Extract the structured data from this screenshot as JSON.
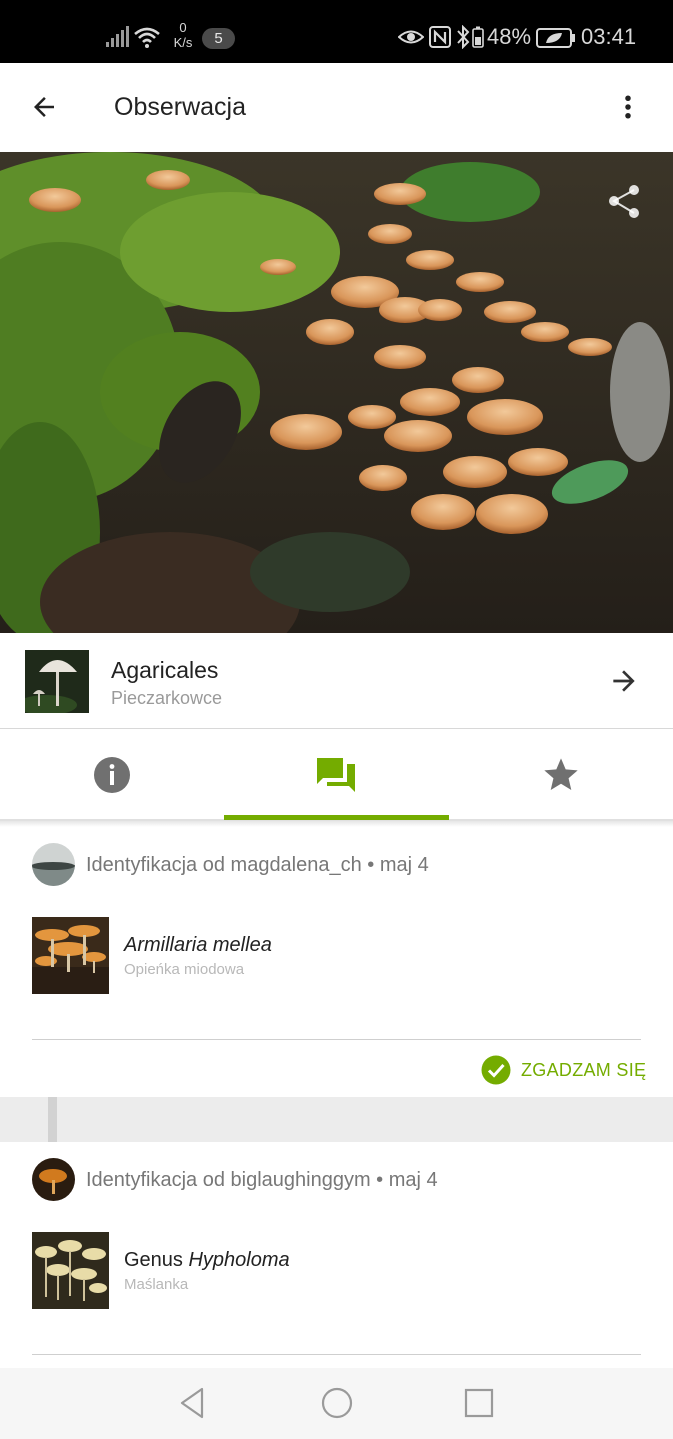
{
  "status_bar": {
    "speed_value": "0",
    "speed_unit": "K/s",
    "notification_count": "5",
    "battery": "48%",
    "time": "03:41"
  },
  "app_bar": {
    "title": "Obserwacja"
  },
  "taxon": {
    "name": "Agaricales",
    "common_name": "Pieczarkowce"
  },
  "tabs": [
    {
      "name": "info",
      "icon": "info-icon",
      "active": false
    },
    {
      "name": "activity",
      "icon": "chat-icon",
      "active": true
    },
    {
      "name": "favorites",
      "icon": "star-icon",
      "active": false
    }
  ],
  "identifications": [
    {
      "header": "Identyfikacja od magdalena_ch • maj 4",
      "taxon_prefix": "",
      "taxon_italic": "Armillaria mellea",
      "common_name": "Opieńka miodowa",
      "agree_label": "ZGADZAM SIĘ"
    },
    {
      "header": "Identyfikacja od biglaughinggym • maj 4",
      "taxon_prefix": "Genus ",
      "taxon_italic": "Hypholoma",
      "common_name": "Maślanka"
    }
  ],
  "colors": {
    "accent": "#74ac00",
    "status_bar_bg": "#000000",
    "secondary_text": "#9a9a9a"
  }
}
